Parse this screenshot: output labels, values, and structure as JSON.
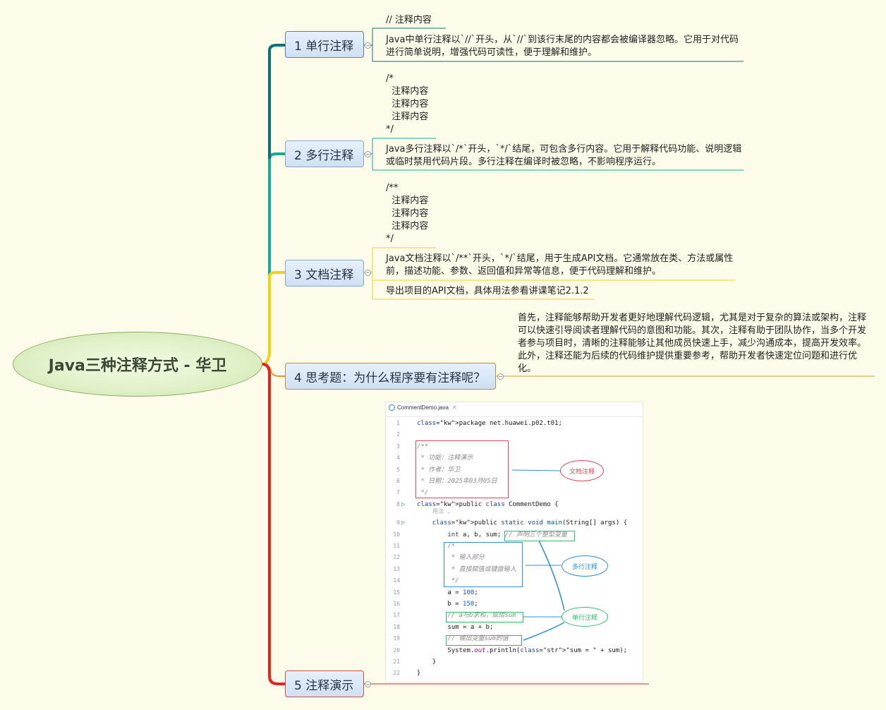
{
  "root": {
    "title": "Java三种注释方式 - 华卫"
  },
  "branches": [
    {
      "label": "1 单行注释",
      "notes": [
        "// 注释内容",
        "Java中单行注释以`//`开头，从`//`到该行末尾的内容都会被编译器忽略。它用于对代码\n进行简单说明，增强代码可读性，便于理解和维护。"
      ]
    },
    {
      "label": "2 多行注释",
      "notes": [
        "/*\n  注释内容\n  注释内容\n  注释内容\n*/",
        "Java多行注释以`/*`开头，`*/`结尾，可包含多行内容。它用于解释代码功能、说明逻辑\n或临时禁用代码片段。多行注释在编译时被忽略，不影响程序运行。"
      ]
    },
    {
      "label": "3 文档注释",
      "notes": [
        "/**\n  注释内容\n  注释内容\n  注释内容\n*/",
        "Java文档注释以`/**`开头，`*/`结尾，用于生成API文档。它通常放在类、方法或属性\n前，描述功能、参数、返回值和异常等信息，便于代码理解和维护。",
        "导出项目的API文档，具体用法参看讲课笔记2.1.2"
      ]
    },
    {
      "label": "4 思考题：为什么程序要有注释呢？",
      "notes": [
        "首先，注释能够帮助开发者更好地理解代码逻辑，尤其是对于复杂的算法或架构，注释\n可以快速引导阅读者理解代码的意图和功能。其次，注释有助于团队协作，当多个开发\n者参与项目时，清晰的注释能够让其他成员快速上手，减少沟通成本，提高开发效率。\n此外，注释还能为后续的代码维护提供重要参考，帮助开发者快速定位问题和进行优\n化。"
      ]
    },
    {
      "label": "5 注释演示",
      "notes": []
    }
  ],
  "code_demo": {
    "tab_title": "CommentDemo.java",
    "usage_hint": "用法",
    "lines": [
      {
        "n": "1",
        "html_key": "l1",
        "text": "package net.huawei.p02.t01;"
      },
      {
        "n": "2",
        "text": ""
      },
      {
        "n": "3",
        "text": "/**"
      },
      {
        "n": "4",
        "text": " * 功能：注释演示"
      },
      {
        "n": "5",
        "text": " * 作者：华卫"
      },
      {
        "n": "6",
        "text": " * 日期：2025年03月05日"
      },
      {
        "n": "7",
        "text": " */"
      },
      {
        "n": "8",
        "text": "public class CommentDemo {"
      },
      {
        "n": "9",
        "text": "    public static void main(String[] args) {"
      },
      {
        "n": "10",
        "text": "        int a, b, sum;"
      },
      {
        "n": "11",
        "text": "        /*"
      },
      {
        "n": "12",
        "text": "         * 输入部分"
      },
      {
        "n": "13",
        "text": "         * 直接赋值或键盘输入"
      },
      {
        "n": "14",
        "text": "         */"
      },
      {
        "n": "15",
        "text": "        a = 100;"
      },
      {
        "n": "16",
        "text": "        b = 150;"
      },
      {
        "n": "17",
        "text": "        // a与b求和，赋给sum"
      },
      {
        "n": "18",
        "text": "        sum = a + b;"
      },
      {
        "n": "19",
        "text": "        // 输出变量sum的值"
      },
      {
        "n": "20",
        "text": "        System.out.println(\"sum = \" + sum);"
      },
      {
        "n": "21",
        "text": "    }"
      },
      {
        "n": "22",
        "text": "}"
      }
    ],
    "inline_comment": "// 声明三个整型变量",
    "callouts": {
      "doc": "文档注释",
      "multi": "多行注释",
      "single": "单行注释"
    }
  },
  "colors": {
    "background": "#fdfcea",
    "branch1": "#0e6f78",
    "branch2": "#1aa89a",
    "branch3": "#f1d21a",
    "branch4": "#e0962e",
    "branch5": "#e0261d",
    "callout_doc": "#e2485a",
    "callout_multi": "#2e8fd8",
    "callout_single": "#2fbf6a"
  }
}
